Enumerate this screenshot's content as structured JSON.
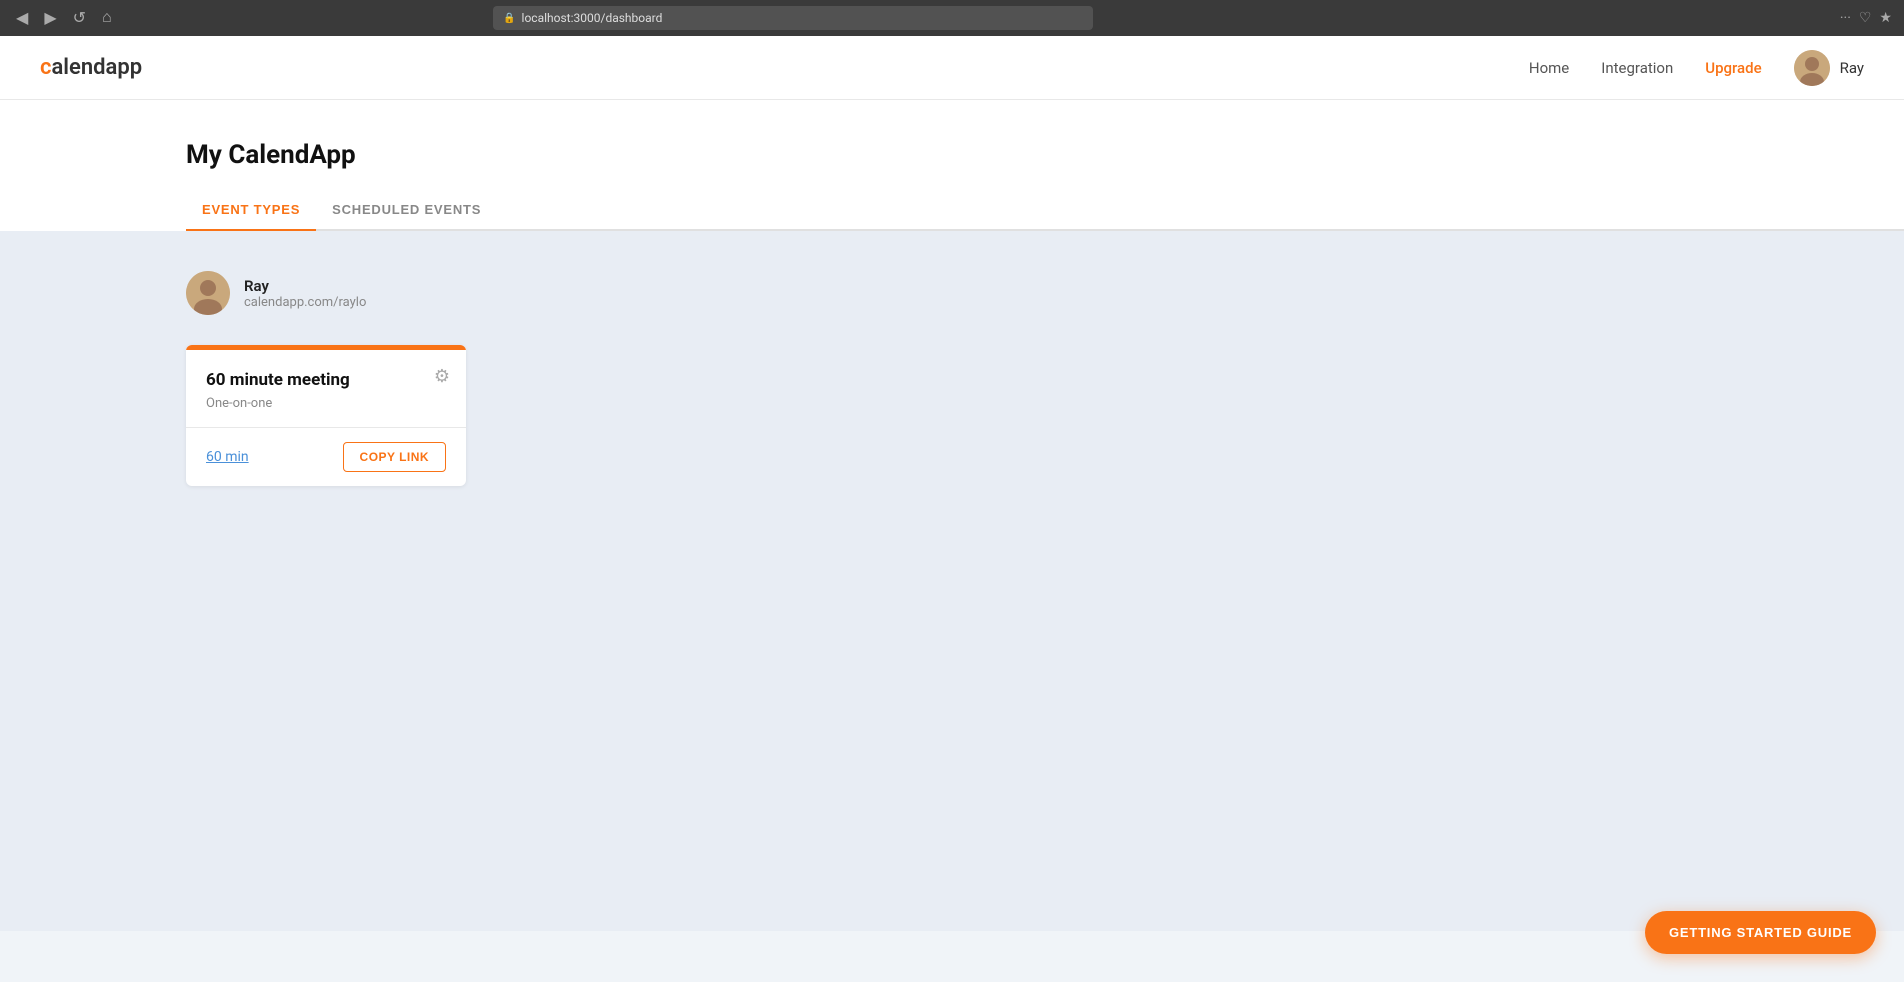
{
  "browser": {
    "url": "localhost:3000/dashboard",
    "back_icon": "◀",
    "forward_icon": "▶",
    "reload_icon": "↺",
    "home_icon": "⌂",
    "more_icon": "···",
    "bookmark_icon": "♡",
    "star_icon": "★"
  },
  "navbar": {
    "logo": {
      "prefix": "calend",
      "highlight_char": "c",
      "suffix": "app"
    },
    "logo_text": "calendapp",
    "nav_links": [
      {
        "label": "Home",
        "id": "home"
      },
      {
        "label": "Integration",
        "id": "integration"
      },
      {
        "label": "Upgrade",
        "id": "upgrade",
        "accent": true
      }
    ],
    "user_name": "Ray"
  },
  "page": {
    "title": "My CalendApp",
    "tabs": [
      {
        "label": "EVENT TYPES",
        "id": "event-types",
        "active": true
      },
      {
        "label": "SCHEDULED EVENTS",
        "id": "scheduled-events",
        "active": false
      }
    ]
  },
  "user_profile": {
    "name": "Ray",
    "url": "calendapp.com/raylo"
  },
  "event_card": {
    "title": "60 minute meeting",
    "subtitle": "One-on-one",
    "duration": "60 min",
    "copy_button_label": "COPY LINK",
    "settings_icon": "⚙"
  },
  "getting_started": {
    "button_label": "GETTING STARTED GUIDE"
  }
}
